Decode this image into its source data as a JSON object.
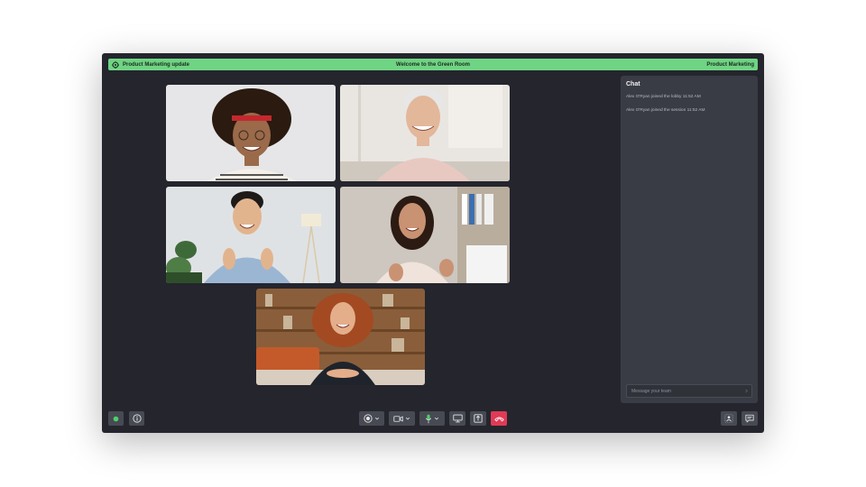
{
  "topbar": {
    "meeting_title": "Product Marketing update",
    "room_title": "Welcome to the Green Room",
    "team_name": "Product Marketing",
    "logo_icon": "gear-logo-icon"
  },
  "participants": [
    {
      "id": "participant-1",
      "skin": "#9a6a4a",
      "hair": "#2a1a10",
      "shirt": "#f4f0e8",
      "bg": "#e6e6e8"
    },
    {
      "id": "participant-2",
      "skin": "#e3b79a",
      "hair": "#e7e7e7",
      "shirt": "#e8c9c2",
      "bg": "#e9e6e1"
    },
    {
      "id": "participant-3",
      "skin": "#e2b48e",
      "hair": "#1d1a18",
      "shirt": "#9bb6d3",
      "bg": "#dfe2e4"
    },
    {
      "id": "participant-4",
      "skin": "#c99273",
      "hair": "#2b1b13",
      "shirt": "#f0e3db",
      "bg": "#cdc7bf"
    },
    {
      "id": "participant-5",
      "skin": "#e4ae8a",
      "hair": "#a34a22",
      "shirt": "#1f232b",
      "bg": "#8a5e3a"
    }
  ],
  "chat": {
    "title": "Chat",
    "messages": [
      "Alex O'Ryan joined the lobby 11:52 AM",
      "Alex O'Ryan joined the session 11:52 AM"
    ],
    "input_placeholder": "Message your team"
  },
  "toolbar": {
    "status_color": "#4cd16a",
    "end_call_color": "#e03a56",
    "icons": [
      "status-indicator",
      "info-icon",
      "record-icon",
      "camera-icon",
      "mic-icon",
      "screen-share-icon",
      "share-icon",
      "end-call-icon",
      "participants-icon",
      "chat-icon"
    ]
  }
}
